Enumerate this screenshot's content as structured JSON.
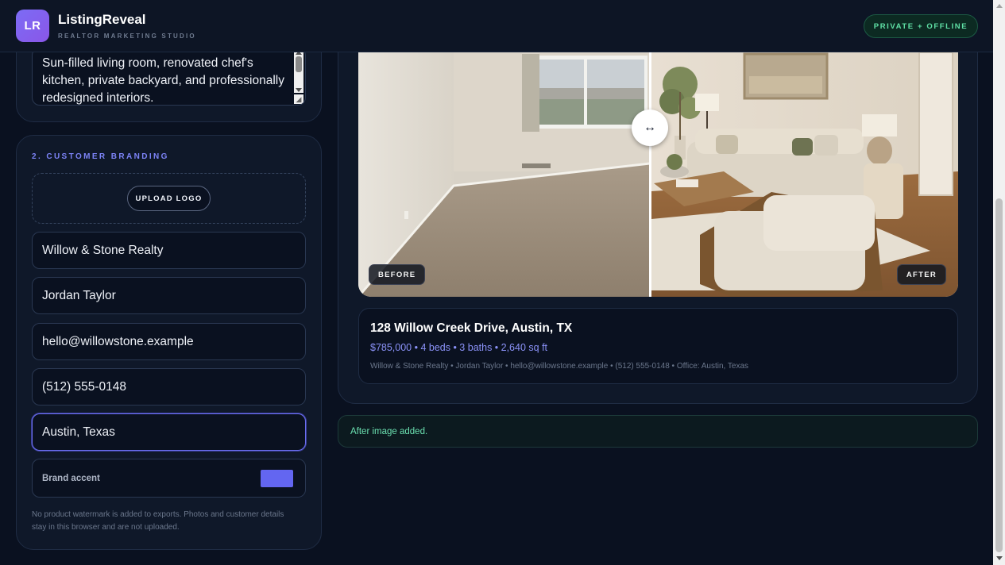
{
  "app": {
    "logo_initials": "LR",
    "name": "ListingReveal",
    "tagline": "REALTOR MARKETING STUDIO",
    "status_badge": "PRIVATE + OFFLINE"
  },
  "description": {
    "text": "Sun-filled living room, renovated chef's kitchen, private backyard, and professionally redesigned interiors."
  },
  "branding": {
    "section_title": "2. CUSTOMER BRANDING",
    "upload_logo_label": "UPLOAD LOGO",
    "brokerage": "Willow & Stone Realty",
    "agent_name": "Jordan Taylor",
    "email": "hello@willowstone.example",
    "phone": "(512) 555-0148",
    "office": "Austin, Texas",
    "accent_label": "Brand accent",
    "accent_color": "#6366f1",
    "privacy_note": "No product watermark is added to exports. Photos and customer details stay in this browser and are not uploaded."
  },
  "preview": {
    "handle_glyph": "↔",
    "before_label": "BEFORE",
    "after_label": "AFTER",
    "address": "128 Willow Creek Drive, Austin, TX",
    "specs": "$785,000 • 4 beds • 3 baths • 2,640 sq ft",
    "contact_line": "Willow & Stone Realty • Jordan Taylor • hello@willowstone.example • (512) 555-0148 • Office: Austin, Texas"
  },
  "toast": {
    "message": "After image added."
  },
  "colors": {
    "background": "#0a1120",
    "card": "#0f1829",
    "accent": "#6366f1",
    "success": "#5fe0a5"
  }
}
